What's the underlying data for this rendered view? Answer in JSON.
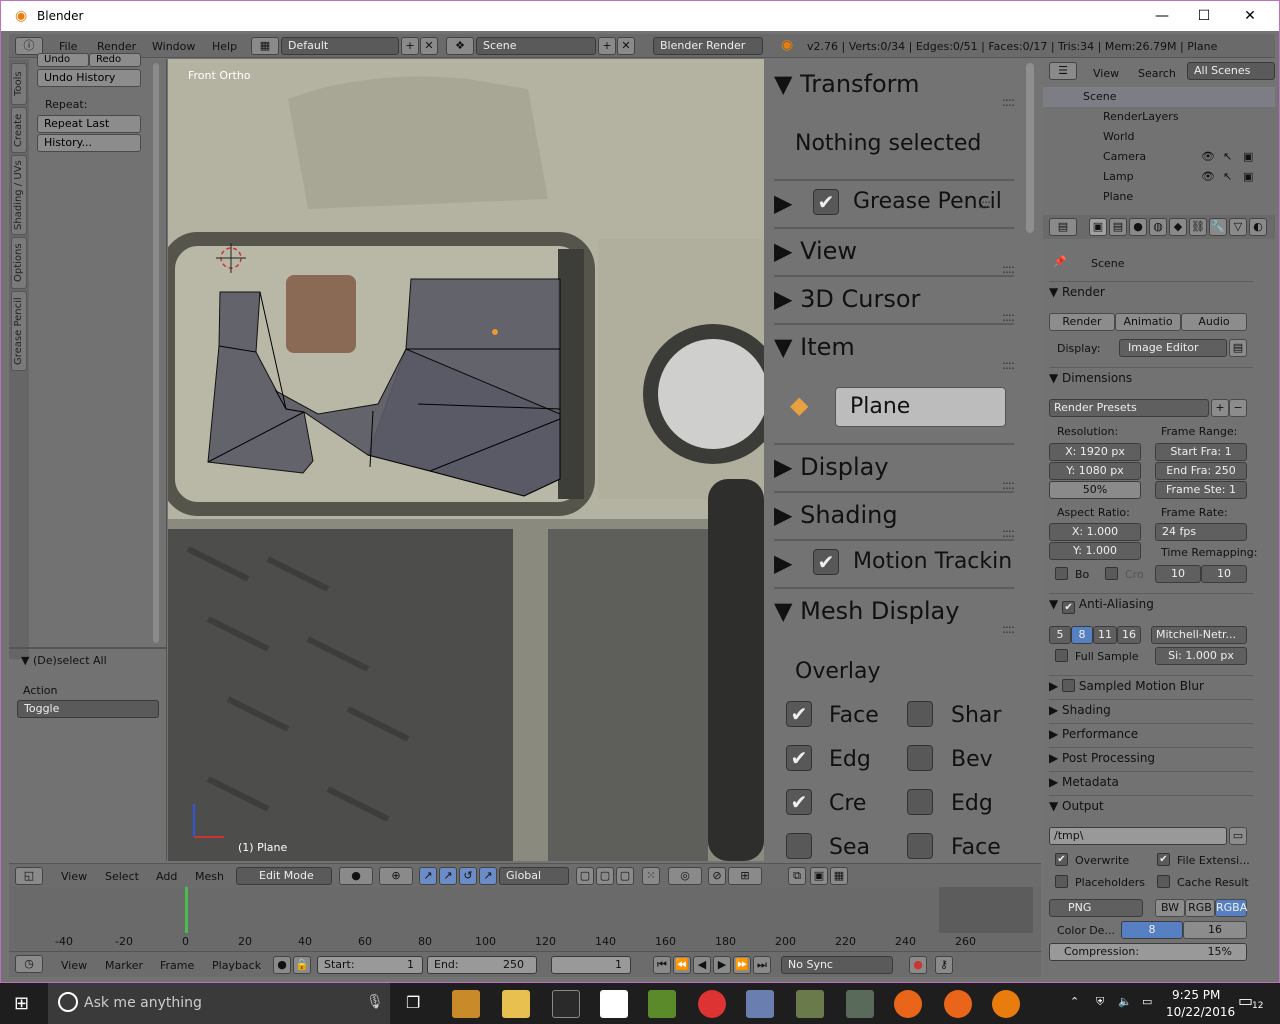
{
  "app": {
    "title": "Blender"
  },
  "topbar": {
    "menus": [
      "File",
      "Render",
      "Window",
      "Help"
    ],
    "layout": "Default",
    "scene": "Scene",
    "engine": "Blender Render",
    "stats": "v2.76 | Verts:0/34 | Edges:0/51 | Faces:0/17 | Tris:34 | Mem:26.79M | Plane"
  },
  "tools": {
    "tabs": [
      "Tools",
      "Create",
      "Shading / UVs",
      "Options",
      "Grease Pencil"
    ],
    "undo": "Undo",
    "redo": "Redo",
    "undo_history": "Undo History",
    "repeat_label": "Repeat:",
    "repeat_last": "Repeat Last",
    "history": "History...",
    "operator_title": "(De)select All",
    "action_label": "Action",
    "action_value": "Toggle"
  },
  "viewport": {
    "view_name": "Front Ortho",
    "object_label": "(1) Plane"
  },
  "npanel": {
    "transform": "Transform",
    "nothing_selected": "Nothing selected",
    "grease_pencil": "Grease Pencil",
    "view": "View",
    "cursor": "3D Cursor",
    "item": "Item",
    "item_name": "Plane",
    "display": "Display",
    "shading": "Shading",
    "motion_tracking": "Motion Trackin",
    "mesh_display": "Mesh Display",
    "overlay": "Overlay",
    "overlay_items": [
      {
        "label": "Face",
        "checked": true
      },
      {
        "label": "Shar",
        "checked": false
      },
      {
        "label": "Edg",
        "checked": true
      },
      {
        "label": "Bev",
        "checked": false
      },
      {
        "label": "Cre",
        "checked": true
      },
      {
        "label": "Edg",
        "checked": false
      },
      {
        "label": "Sea",
        "checked": false
      },
      {
        "label": "Face",
        "checked": false
      }
    ]
  },
  "outliner": {
    "menus": [
      "View",
      "Search"
    ],
    "filter": "All Scenes",
    "items": [
      "Scene",
      "RenderLayers",
      "World",
      "Camera",
      "Lamp",
      "Plane"
    ]
  },
  "props": {
    "context": "Scene",
    "render_section": "Render",
    "render_btn": "Render",
    "anim_btn": "Animatio",
    "audio_btn": "Audio",
    "display_label": "Display:",
    "display_value": "Image Editor",
    "dimensions": "Dimensions",
    "presets": "Render Presets",
    "resolution_label": "Resolution:",
    "res_x": "X:  1920 px",
    "res_y": "Y:  1080 px",
    "res_pct": "50%",
    "frame_range_label": "Frame Range:",
    "start": "Start Fra:   1",
    "end": "End Fra: 250",
    "step": "Frame Ste: 1",
    "aspect_label": "Aspect Ratio:",
    "asp_x": "X:   1.000",
    "asp_y": "Y:   1.000",
    "frame_rate_label": "Frame Rate:",
    "fps": "24 fps",
    "remap_label": "Time Remapping:",
    "bo": "Bo",
    "cro": "Cro",
    "remap_old": "10",
    "remap_new": "10",
    "aa": "Anti-Aliasing",
    "aa_samples": [
      "5",
      "8",
      "11",
      "16"
    ],
    "aa_filter": "Mitchell-Netr...",
    "full_sample": "Full Sample",
    "filter_size": "Si: 1.000 px",
    "motion_blur": "Sampled Motion Blur",
    "shading": "Shading",
    "performance": "Performance",
    "post": "Post Processing",
    "metadata": "Metadata",
    "output": "Output",
    "path": "/tmp\\",
    "overwrite": "Overwrite",
    "file_ext": "File Extensi...",
    "placeholders": "Placeholders",
    "cache": "Cache Result",
    "format": "PNG",
    "bw": "BW",
    "rgb": "RGB",
    "rgba": "RGBA",
    "color_depth_label": "Color De...",
    "depth_8": "8",
    "depth_16": "16",
    "compression": "Compression:",
    "compression_val": "15%"
  },
  "vheader": {
    "menus": [
      "View",
      "Select",
      "Add",
      "Mesh"
    ],
    "mode": "Edit Mode",
    "orientation": "Global"
  },
  "timeline": {
    "ticks": [
      "-40",
      "-20",
      "0",
      "20",
      "40",
      "60",
      "80",
      "100",
      "120",
      "140",
      "160",
      "180",
      "200",
      "220",
      "240",
      "260"
    ],
    "menus": [
      "View",
      "Marker",
      "Frame",
      "Playback"
    ],
    "start": "Start:",
    "start_val": "1",
    "end": "End:",
    "end_val": "250",
    "current": "1",
    "sync": "No Sync"
  },
  "taskbar": {
    "search": "Ask me anything",
    "time": "9:25 PM",
    "date": "10/22/2016",
    "notif": "12"
  },
  "colors": {
    "accent": "#5680c2",
    "panel": "#737373"
  }
}
